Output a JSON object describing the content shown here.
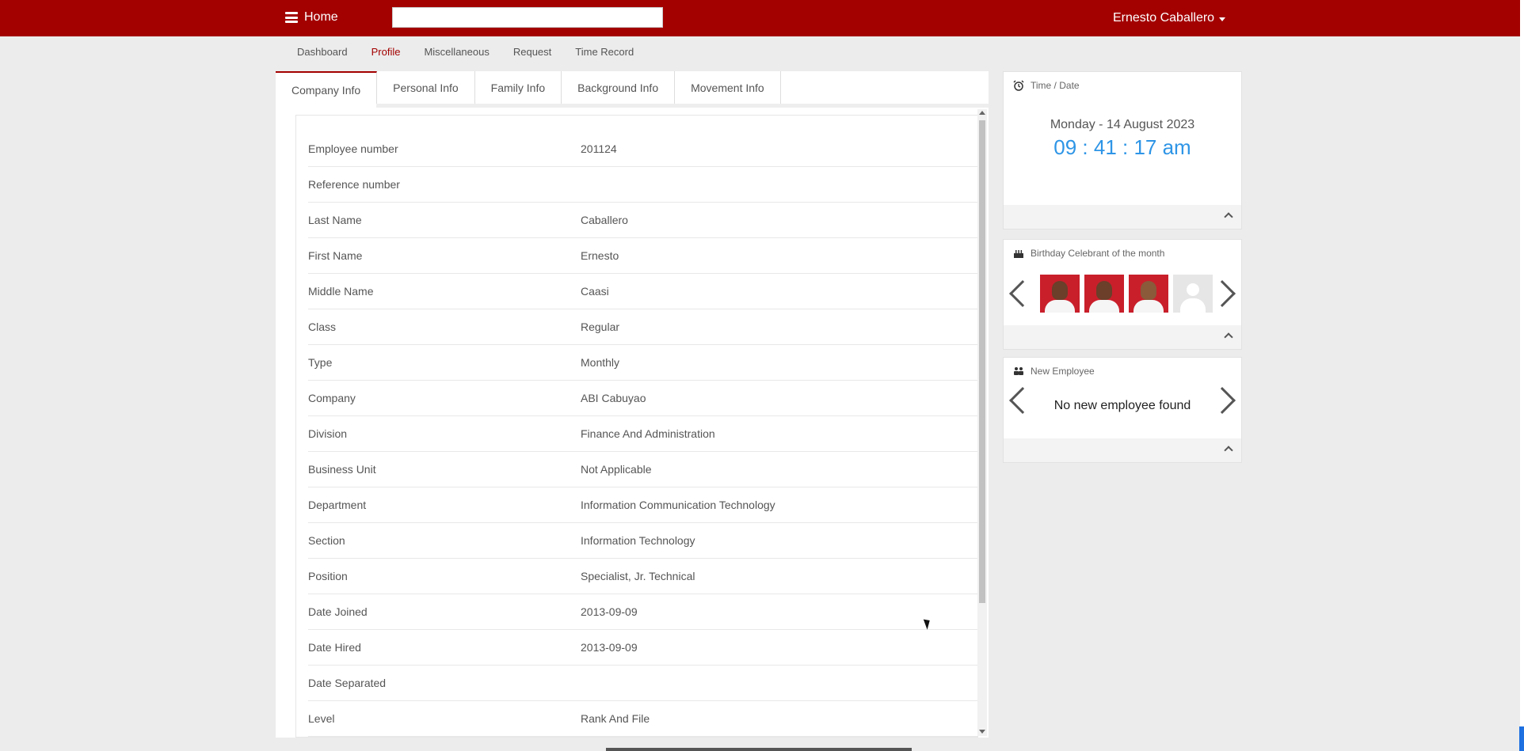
{
  "header": {
    "home_label": "Home",
    "user_name": "Ernesto Caballero",
    "search_value": ""
  },
  "nav": {
    "items": [
      "Dashboard",
      "Profile",
      "Miscellaneous",
      "Request",
      "Time Record"
    ],
    "active": "Profile"
  },
  "tabs": [
    "Company Info",
    "Personal Info",
    "Family Info",
    "Background Info",
    "Movement Info"
  ],
  "company_info": [
    {
      "label": "Employee number",
      "value": "201124"
    },
    {
      "label": "Reference number",
      "value": ""
    },
    {
      "label": "Last Name",
      "value": "Caballero"
    },
    {
      "label": "First Name",
      "value": "Ernesto"
    },
    {
      "label": "Middle Name",
      "value": "Caasi"
    },
    {
      "label": "Class",
      "value": "Regular"
    },
    {
      "label": "Type",
      "value": "Monthly"
    },
    {
      "label": "Company",
      "value": "ABI Cabuyao"
    },
    {
      "label": "Division",
      "value": "Finance And Administration"
    },
    {
      "label": "Business Unit",
      "value": "Not Applicable"
    },
    {
      "label": "Department",
      "value": "Information Communication Technology"
    },
    {
      "label": "Section",
      "value": "Information Technology"
    },
    {
      "label": "Position",
      "value": "Specialist, Jr. Technical"
    },
    {
      "label": "Date Joined",
      "value": "2013-09-09"
    },
    {
      "label": "Date Hired",
      "value": "2013-09-09"
    },
    {
      "label": "Date Separated",
      "value": ""
    },
    {
      "label": "Level",
      "value": "Rank And File"
    }
  ],
  "widgets": {
    "time": {
      "title": "Time / Date",
      "date": "Monday - 14 August 2023",
      "time": "09 : 41 : 17 am"
    },
    "birthday": {
      "title": "Birthday Celebrant of the month"
    },
    "new_employee": {
      "title": "New Employee",
      "message": "No new employee found"
    }
  },
  "colors": {
    "brand": "#a30000",
    "clock": "#2e95e6"
  }
}
